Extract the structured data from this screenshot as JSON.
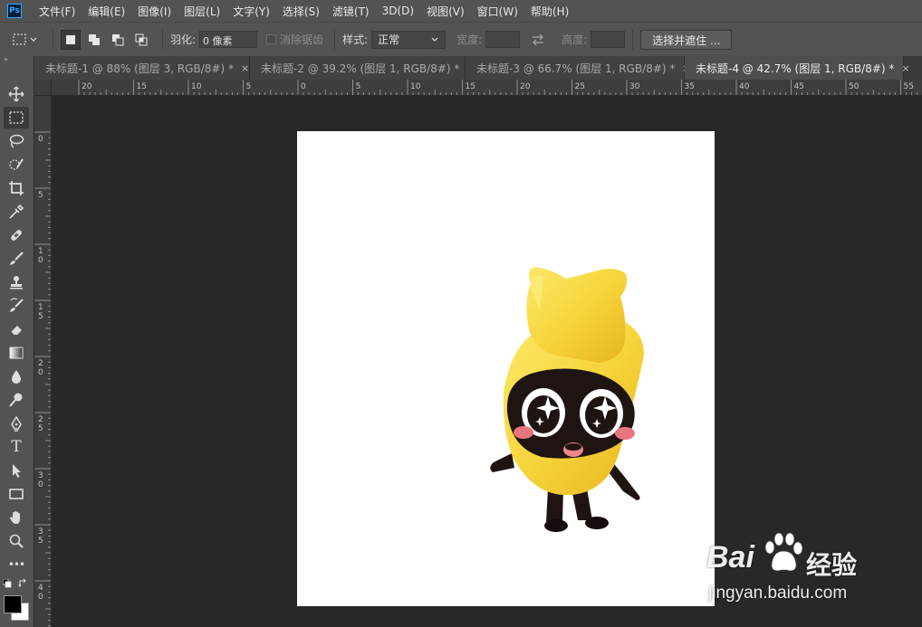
{
  "menu": {
    "app_icon_label": "Ps",
    "items": [
      "文件(F)",
      "编辑(E)",
      "图像(I)",
      "图层(L)",
      "文字(Y)",
      "选择(S)",
      "滤镜(T)",
      "3D(D)",
      "视图(V)",
      "窗口(W)",
      "帮助(H)"
    ]
  },
  "options": {
    "feather_label": "羽化:",
    "feather_value": "0 像素",
    "antialias_label": "消除锯齿",
    "style_label": "样式:",
    "style_value": "正常",
    "width_label": "宽度:",
    "height_label": "高度:",
    "select_mask_button": "选择并遮住 ..."
  },
  "tabs": [
    {
      "label": "未标题-1 @ 88% (图层 3, RGB/8#) *",
      "close": "×",
      "active": false
    },
    {
      "label": "未标题-2 @ 39.2% (图层 1, RGB/8#) *",
      "close": "×",
      "active": false
    },
    {
      "label": "未标题-3 @ 66.7% (图层 1, RGB/8#) *",
      "close": "×",
      "active": false
    },
    {
      "label": "未标题-4 @ 42.7% (图层 1, RGB/8#) *",
      "close": "×",
      "active": true
    }
  ],
  "ruler_top_labels": [
    "20",
    "15",
    "10",
    "5",
    "0",
    "5",
    "10",
    "15",
    "20",
    "25",
    "30",
    "35",
    "40",
    "45",
    "50",
    "55"
  ],
  "ruler_left_labels": [
    "0",
    "5",
    "1 0",
    "1 5",
    "2 0",
    "2 5",
    "3 0",
    "3 5",
    "4 0"
  ],
  "toolbar": {
    "collapse_glyph": "»",
    "more_glyph": "•••",
    "type_tool_glyph": "T"
  },
  "colors": {
    "foreground": "#000000",
    "background": "#ffffff",
    "character_yellow": "#f5d53b",
    "character_face": "#1e1512"
  },
  "watermark": {
    "brand_left": "Bai",
    "brand_right": "经验",
    "url": "jingyan.baidu.com"
  }
}
